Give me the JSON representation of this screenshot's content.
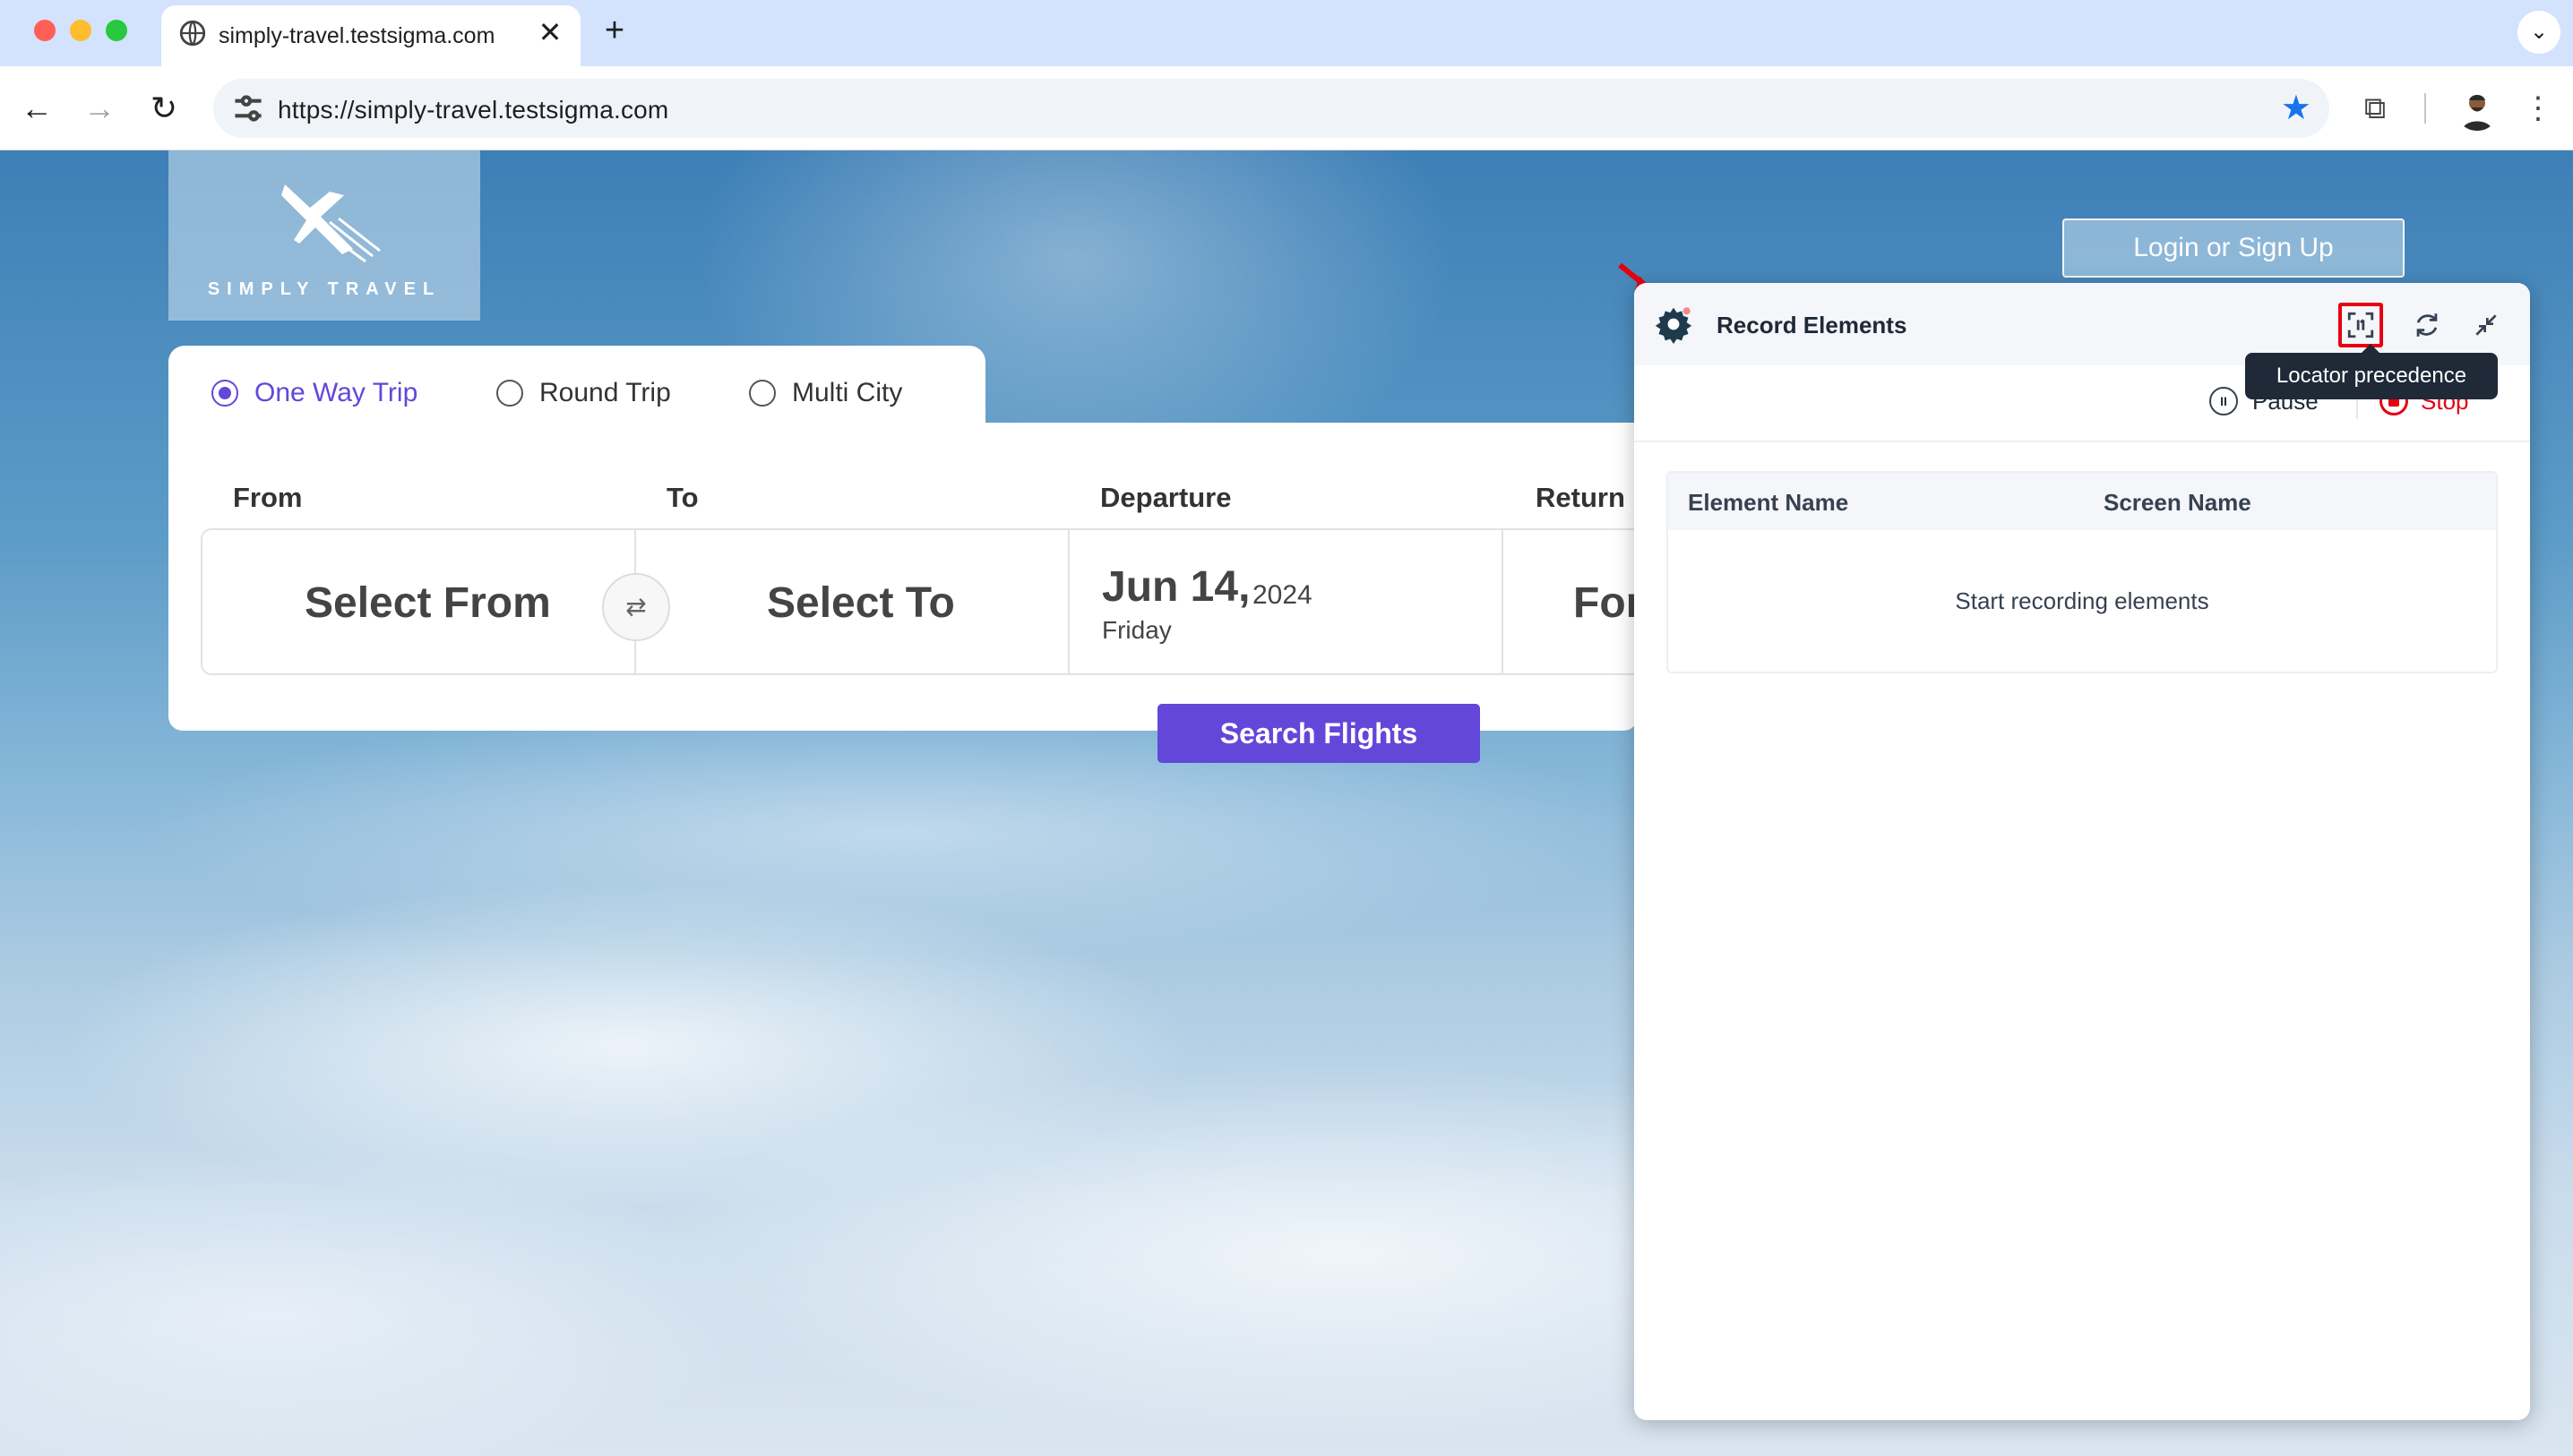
{
  "browser": {
    "tab_title": "simply-travel.testsigma.com",
    "tab_close": "✕",
    "new_tab": "+",
    "tab_menu": "⌄",
    "url": "https://simply-travel.testsigma.com",
    "nav": {
      "back": "←",
      "forward": "→",
      "reload": "↻"
    },
    "star": "★",
    "extensions": "⧉",
    "menu": "⋮",
    "icons": [
      "globe-icon",
      "tune-icon",
      "star-icon",
      "puzzle-icon",
      "kebab-menu-icon"
    ]
  },
  "site": {
    "brand": "SIMPLY TRAVEL",
    "login_label": "Login or Sign Up",
    "trip_types": [
      {
        "label": "One Way Trip",
        "selected": true
      },
      {
        "label": "Round Trip",
        "selected": false
      },
      {
        "label": "Multi City",
        "selected": false
      }
    ],
    "fields": {
      "from_label": "From",
      "to_label": "To",
      "departure_label": "Departure",
      "return_label": "Return",
      "from_value": "Select From",
      "swap": "⇄",
      "to_value": "Select To",
      "departure_date": "Jun 14,",
      "departure_year": "2024",
      "departure_day": "Friday",
      "return_value": "For"
    },
    "search_label": "Search Flights",
    "accent_color": "#6347d8"
  },
  "panel": {
    "title": "Record Elements",
    "tooltip": "Locator precedence",
    "pause_label": "Pause",
    "stop_label": "Stop",
    "columns": [
      "Element Name",
      "Screen Name"
    ],
    "empty_text": "Start recording elements",
    "highlight_color": "#e60012"
  }
}
